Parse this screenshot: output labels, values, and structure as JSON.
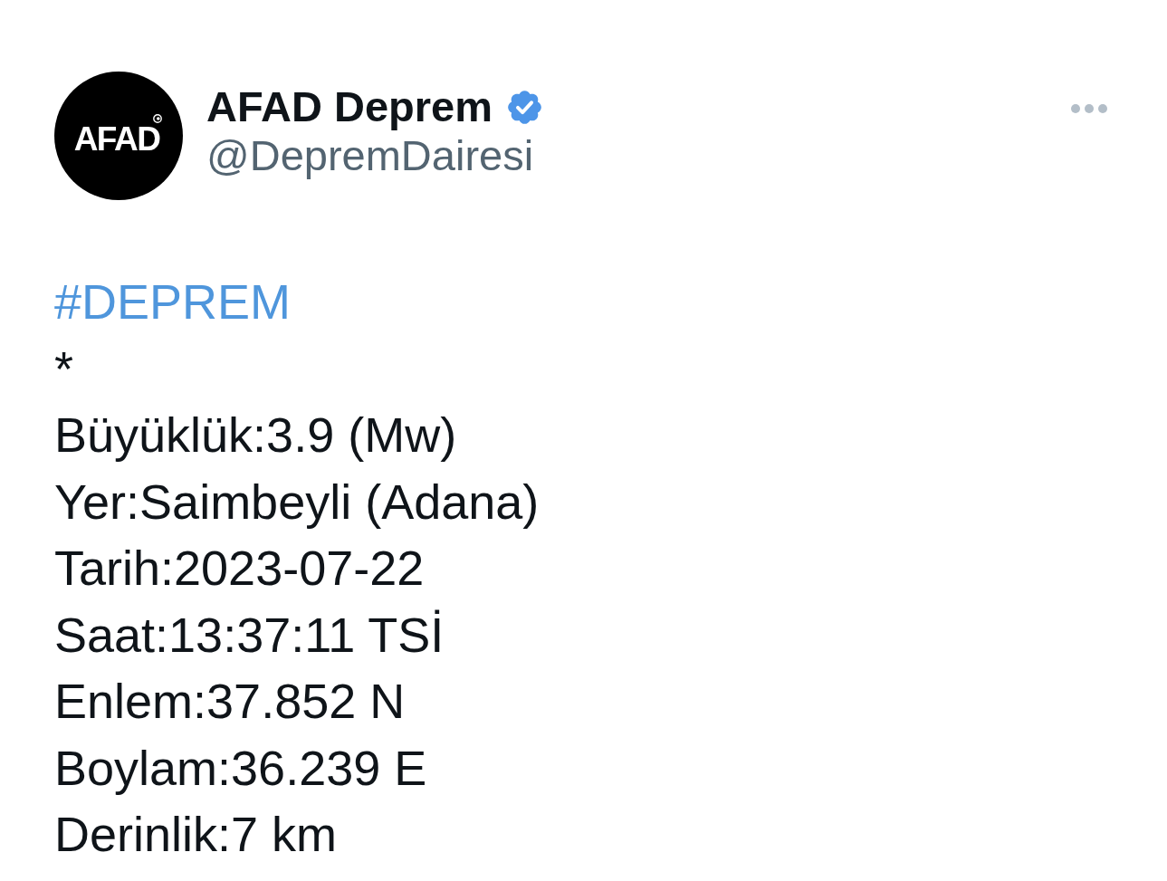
{
  "tweet": {
    "author": {
      "avatar_logo": "AFAD",
      "name": "AFAD Deprem",
      "verified": true,
      "handle": "@DepremDairesi"
    },
    "text_lines": [
      {
        "kind": "hashtag",
        "text": "#DEPREM"
      },
      {
        "kind": "plain",
        "text": "*"
      },
      {
        "kind": "plain",
        "text": "Büyüklük:3.9 (Mw)"
      },
      {
        "kind": "plain",
        "text": "Yer:Saimbeyli (Adana)"
      },
      {
        "kind": "plain",
        "text": "Tarih:2023-07-22"
      },
      {
        "kind": "plain",
        "text": "Saat:13:37:11 TSİ"
      },
      {
        "kind": "plain",
        "text": "Enlem:37.852 N"
      },
      {
        "kind": "plain",
        "text": "Boylam:36.239 E"
      },
      {
        "kind": "plain",
        "text": "Derinlik:7 km"
      }
    ]
  }
}
